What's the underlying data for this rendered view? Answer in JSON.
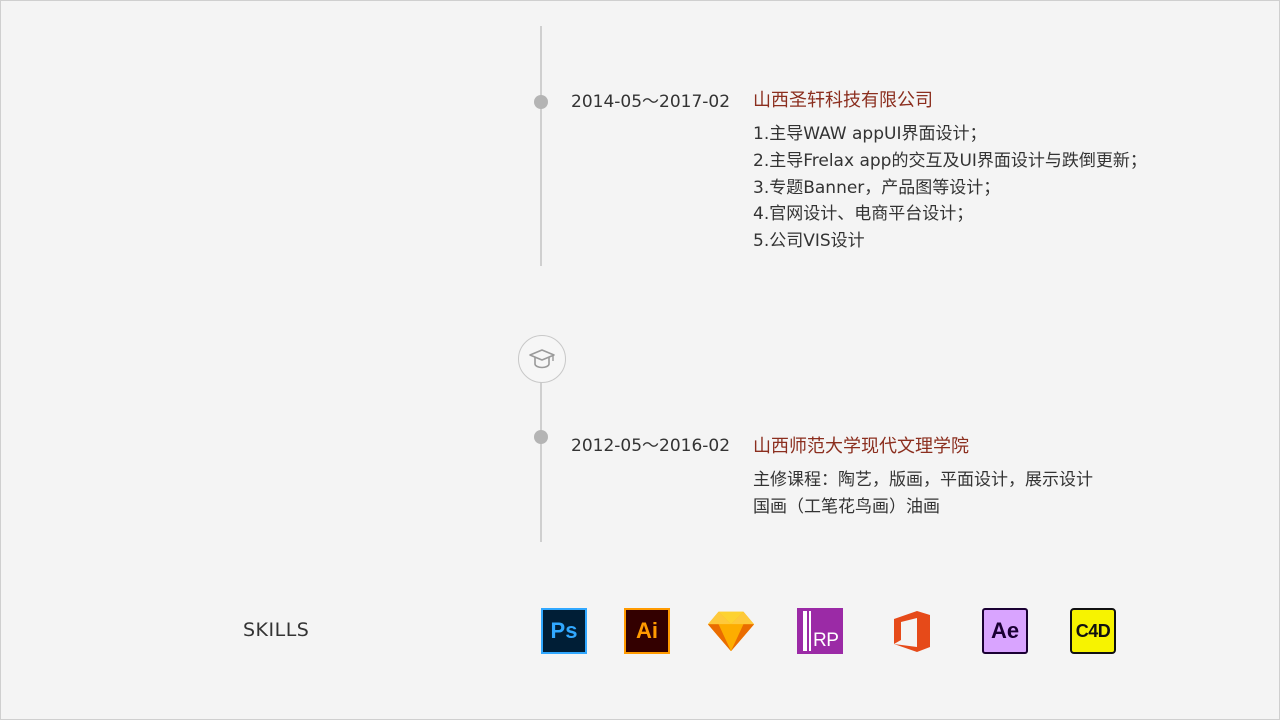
{
  "work": {
    "date": "2014-05～2017-02",
    "org": "山西圣轩科技有限公司",
    "duties": [
      "1.主导WAW appUI界面设计；",
      "2.主导Frelax app的交互及UI界面设计与跌倒更新；",
      "3.专题Banner，产品图等设计；",
      "4.官网设计、电商平台设计；",
      "5.公司VIS设计"
    ]
  },
  "education": {
    "icon": "graduation-cap-icon",
    "date": "2012-05～2016-02",
    "org": "山西师范大学现代文理学院",
    "courses": [
      "主修课程：陶艺，版画，平面设计，展示设计",
      "国画（工笔花鸟画）油画"
    ]
  },
  "skills": {
    "title": "SKILLS",
    "items": [
      {
        "name": "photoshop-icon",
        "label": "Ps",
        "fg": "#31a8ff",
        "bg": "#001e36"
      },
      {
        "name": "illustrator-icon",
        "label": "Ai",
        "fg": "#ff9a00",
        "bg": "#330000"
      },
      {
        "name": "sketch-icon",
        "label": "",
        "fg": "#fdad00",
        "bg": ""
      },
      {
        "name": "axure-rp-icon",
        "label": "RP",
        "fg": "#ffffff",
        "bg": "#8e24aa"
      },
      {
        "name": "office-icon",
        "label": "",
        "fg": "#e64a19",
        "bg": ""
      },
      {
        "name": "after-effects-icon",
        "label": "Ae",
        "fg": "#1a0033",
        "bg": "#d291ff"
      },
      {
        "name": "cinema4d-icon",
        "label": "C4D",
        "fg": "#111111",
        "bg": "#f7f300"
      }
    ]
  },
  "colors": {
    "org_title": "#8b2e1e",
    "timeline": "#cfcfcf",
    "dot": "#b4b4b4",
    "background": "#f4f4f4"
  }
}
